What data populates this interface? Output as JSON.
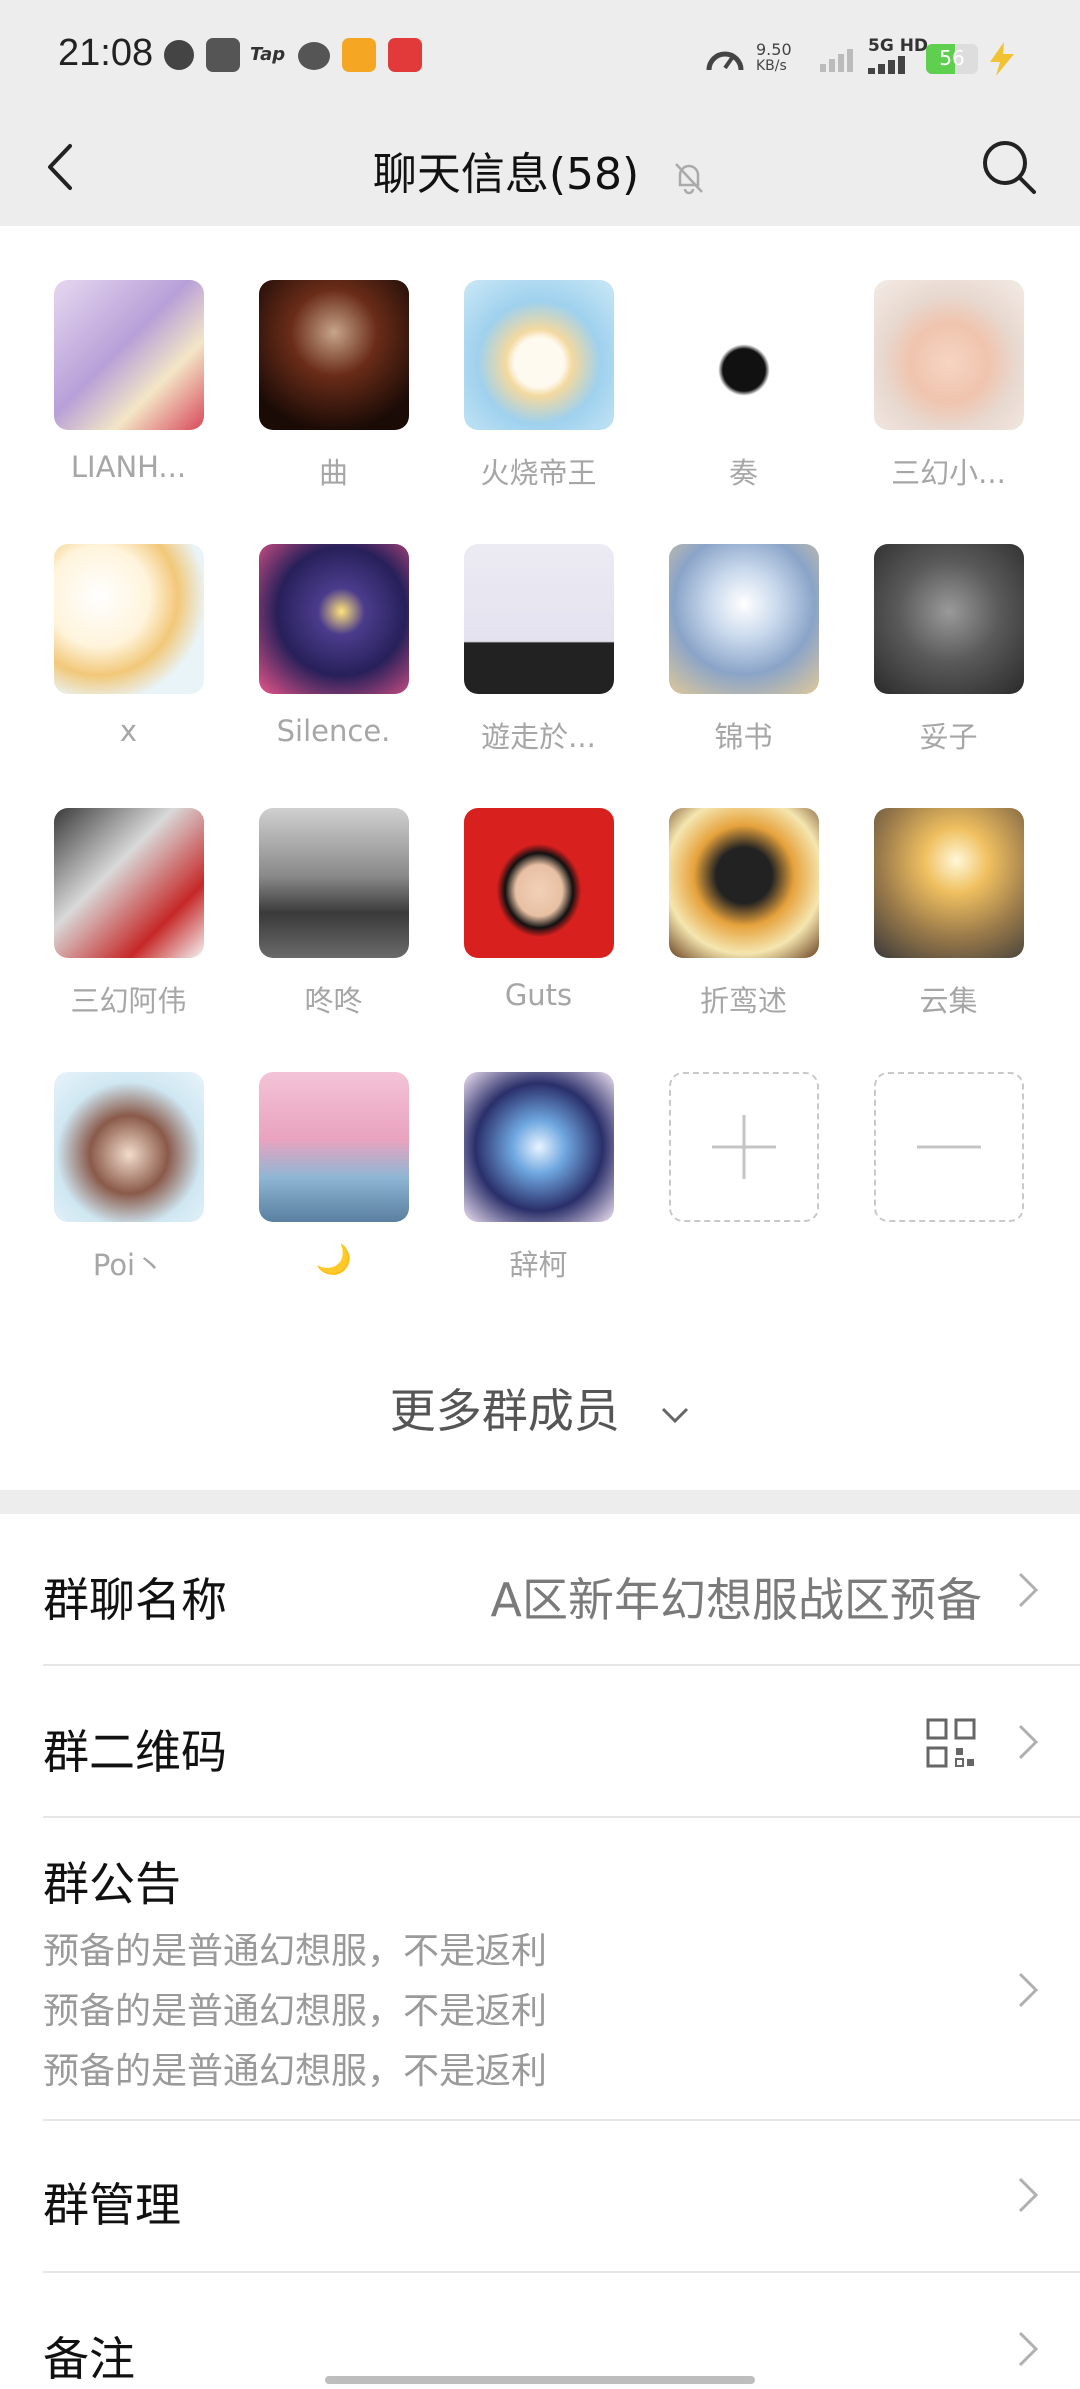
{
  "status_bar": {
    "time": "21:08",
    "speed_value": "9.50",
    "speed_unit": "KB/s",
    "network": "5G HD",
    "battery": "56"
  },
  "nav": {
    "title": "聊天信息(58)"
  },
  "members": [
    {
      "name": "LIANH..."
    },
    {
      "name": "曲"
    },
    {
      "name": "火烧帝王"
    },
    {
      "name": "奏"
    },
    {
      "name": "三幻小..."
    },
    {
      "name": "x"
    },
    {
      "name": "Silence."
    },
    {
      "name": "遊走於..."
    },
    {
      "name": "锦书"
    },
    {
      "name": "妥子"
    },
    {
      "name": "三幻阿伟"
    },
    {
      "name": "咚咚"
    },
    {
      "name": "Guts"
    },
    {
      "name": "折鸾述"
    },
    {
      "name": "云集"
    },
    {
      "name": "Poi丶"
    },
    {
      "name": "🌙"
    },
    {
      "name": "辞柯"
    }
  ],
  "more_members_label": "更多群成员",
  "settings": {
    "group_name_label": "群聊名称",
    "group_name_value": "A区新年幻想服战区预备",
    "qr_label": "群二维码",
    "notice_label": "群公告",
    "notice_lines": [
      "预备的是普通幻想服，不是返利",
      "预备的是普通幻想服，不是返利",
      "预备的是普通幻想服，不是返利"
    ],
    "manage_label": "群管理",
    "remark_label": "备注"
  }
}
